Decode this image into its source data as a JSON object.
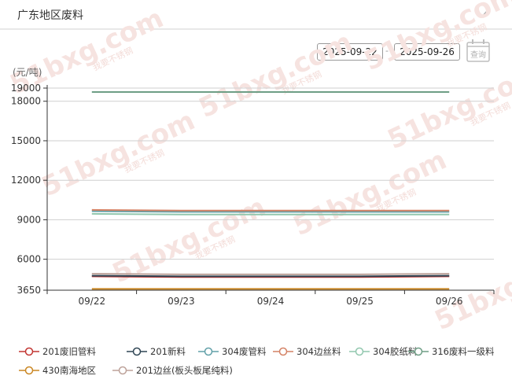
{
  "header": {
    "title": "广东地区废料"
  },
  "date_range": {
    "start": "2025-09-22",
    "separator": "-",
    "end": "2025-09-26",
    "query_label": "查询"
  },
  "watermark": {
    "text": "51bxg.com",
    "subtext": "我要不锈钢"
  },
  "chart_data": {
    "type": "line",
    "unit_label": "(元/吨)",
    "x": [
      "09/22",
      "09/23",
      "09/24",
      "09/25",
      "09/26"
    ],
    "y_ticks": [
      3650,
      6000,
      9000,
      12000,
      15000,
      18000,
      19000
    ],
    "ylim": [
      3650,
      19000
    ],
    "grid": true,
    "legend_position": "bottom",
    "series": [
      {
        "name": "201废旧管料",
        "color": "#c23531",
        "values": [
          4700,
          4650,
          4650,
          4650,
          4700
        ]
      },
      {
        "name": "201新料",
        "color": "#2f4554",
        "values": [
          4750,
          4700,
          4700,
          4700,
          4750
        ]
      },
      {
        "name": "304废管料",
        "color": "#61a0a8",
        "values": [
          9650,
          9600,
          9600,
          9600,
          9600
        ]
      },
      {
        "name": "304边丝料",
        "color": "#d48265",
        "values": [
          9750,
          9700,
          9700,
          9700,
          9700
        ]
      },
      {
        "name": "304胶纸料",
        "color": "#91c7ae",
        "values": [
          9450,
          9400,
          9400,
          9400,
          9400
        ]
      },
      {
        "name": "316废料一级料",
        "color": "#6e9e85",
        "values": [
          18700,
          18700,
          18700,
          18700,
          18700
        ]
      },
      {
        "name": "430南海地区",
        "color": "#ca8622",
        "values": [
          3750,
          3750,
          3750,
          3750,
          3750
        ]
      },
      {
        "name": "201边丝(板头板尾纯料)",
        "color": "#bda29a",
        "values": [
          4900,
          4850,
          4850,
          4850,
          4900
        ]
      }
    ]
  }
}
